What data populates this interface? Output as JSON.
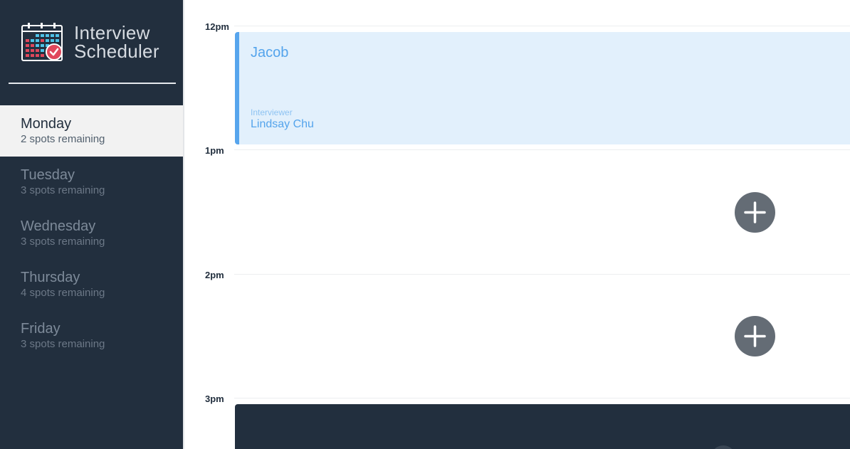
{
  "brand": {
    "line1": "Interview",
    "line2": "Scheduler",
    "icon": "calendar-check-icon"
  },
  "days": [
    {
      "name": "Monday",
      "spots": "2 spots remaining",
      "selected": true
    },
    {
      "name": "Tuesday",
      "spots": "3 spots remaining",
      "selected": false
    },
    {
      "name": "Wednesday",
      "spots": "3 spots remaining",
      "selected": false
    },
    {
      "name": "Thursday",
      "spots": "4 spots remaining",
      "selected": false
    },
    {
      "name": "Friday",
      "spots": "3 spots remaining",
      "selected": false
    }
  ],
  "schedule": {
    "hours": [
      "12pm",
      "1pm",
      "2pm",
      "3pm"
    ],
    "appointment": {
      "student": "Jacob",
      "interviewer_label": "Interviewer",
      "interviewer_name": "Lindsay Chu"
    },
    "add_icon": "plus-icon"
  },
  "colors": {
    "sidebar": "#222f3e",
    "selected_day_bg": "#f2f2f2",
    "appointment_bg": "#e2f0fc",
    "appointment_accent": "#57a5ed",
    "add_button": "#646c75"
  }
}
